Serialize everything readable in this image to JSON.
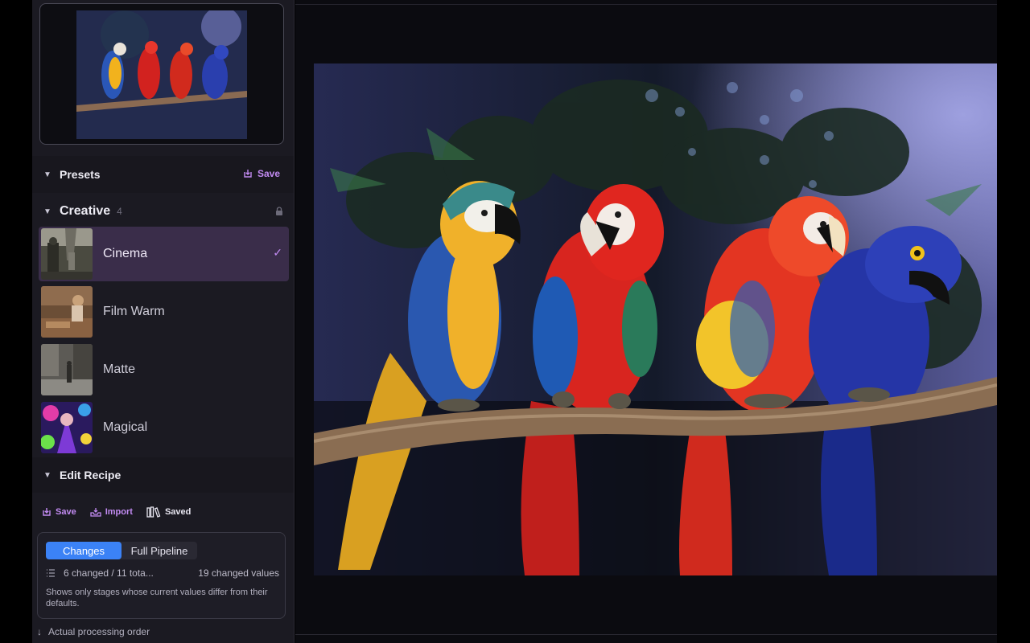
{
  "presets": {
    "title": "Presets",
    "save_label": "Save"
  },
  "creative": {
    "title": "Creative",
    "count": "4",
    "items": [
      {
        "label": "Cinema",
        "selected": true
      },
      {
        "label": "Film Warm",
        "selected": false
      },
      {
        "label": "Matte",
        "selected": false
      },
      {
        "label": "Magical",
        "selected": false
      }
    ]
  },
  "recipe": {
    "title": "Edit Recipe",
    "actions": {
      "save": "Save",
      "import": "Import",
      "saved": "Saved"
    },
    "tabs": {
      "changes": "Changes",
      "full_pipeline": "Full Pipeline"
    },
    "changed_summary": "6 changed / 11 tota...",
    "changed_values": "19 changed values",
    "description": "Shows only stages whose current values differ from their defaults.",
    "order_note": "Actual processing order"
  },
  "colors": {
    "accent": "#c28bf2",
    "tab_active": "#3b82f6",
    "selected_row": "#3a2d4a"
  },
  "icons": {
    "presets_chevron": "chevron-down-icon",
    "save": "save-icon",
    "lock": "lock-icon",
    "check": "checkmark-icon",
    "import": "import-icon",
    "saved": "library-icon",
    "list": "list-icon",
    "order": "arrow-down-icon"
  }
}
